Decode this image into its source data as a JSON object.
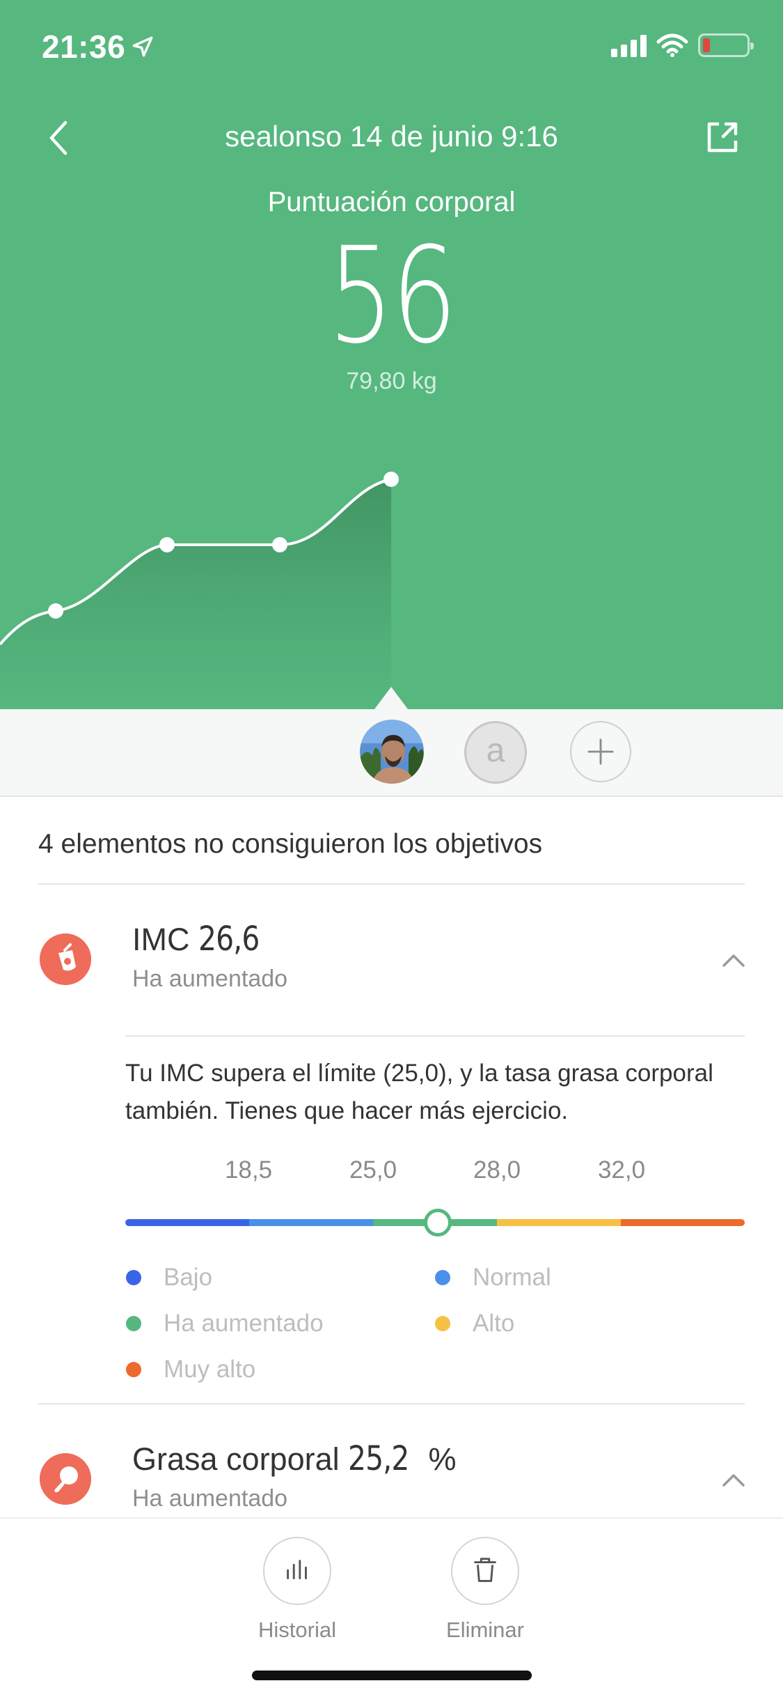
{
  "status_bar": {
    "time": "21:36"
  },
  "header": {
    "title": "sealonso 14 de junio 9:16",
    "score_label": "Puntuación corporal",
    "score": "56",
    "weight": "79,80 kg"
  },
  "users": {
    "second_initial": "a"
  },
  "summary": "4 elementos no consiguieron los objetivos",
  "metrics": [
    {
      "name": "IMC",
      "value": "26,6",
      "status": "Ha aumentado",
      "description": "Tu IMC supera el límite (25,0), y la tasa grasa corporal también. Tienes que hacer más ejercicio.",
      "scale_labels": [
        "18,5",
        "25,0",
        "28,0",
        "32,0"
      ],
      "scale_colors": [
        "#3a64e8",
        "#4a90e8",
        "#56b77f",
        "#f5c043",
        "#ec6a2d"
      ],
      "legend": [
        {
          "label": "Bajo",
          "color": "#3a64e8"
        },
        {
          "label": "Normal",
          "color": "#4a90e8"
        },
        {
          "label": "Ha aumentado",
          "color": "#56b77f"
        },
        {
          "label": "Alto",
          "color": "#f5c043"
        },
        {
          "label": "Muy alto",
          "color": "#ec6a2d"
        }
      ]
    },
    {
      "name": "Grasa corporal",
      "value": "25,2",
      "unit": "%",
      "status": "Ha aumentado"
    }
  ],
  "toolbar": {
    "history_label": "Historial",
    "delete_label": "Eliminar"
  },
  "colors": {
    "primary_green": "#56b77f",
    "alert_red": "#ef6c5a"
  }
}
